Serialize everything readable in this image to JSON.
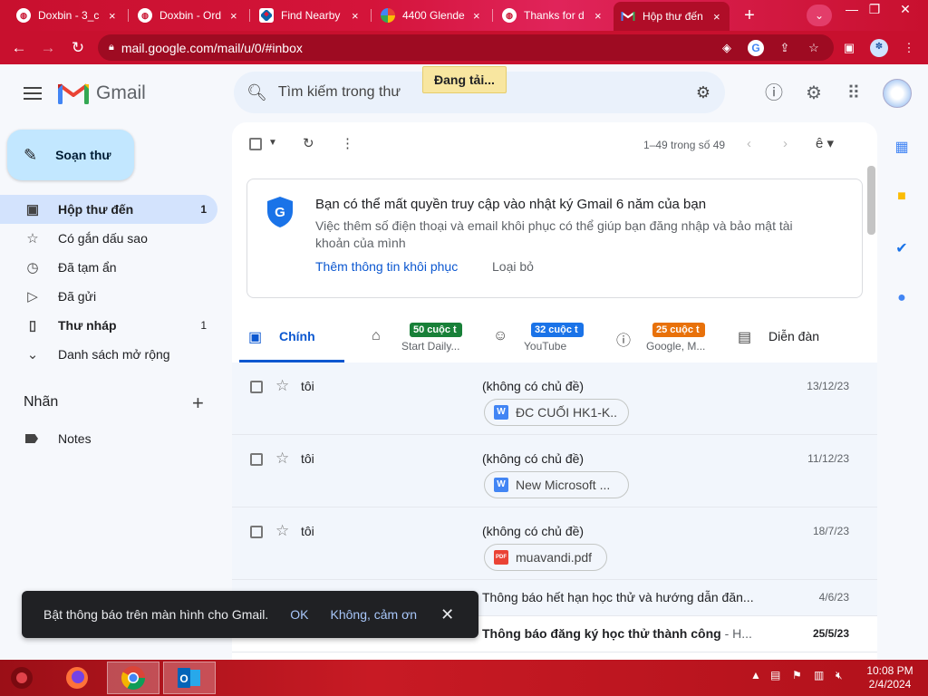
{
  "browser": {
    "tabs": [
      {
        "label": "Doxbin - 3_c",
        "close": "×"
      },
      {
        "label": "Doxbin - Ord",
        "close": "×"
      },
      {
        "label": "Find Nearby",
        "close": "×"
      },
      {
        "label": "4400 Glende",
        "close": "×"
      },
      {
        "label": "Thanks for d",
        "close": "×"
      },
      {
        "label": "Hộp thư đến",
        "close": "×"
      }
    ],
    "url": "mail.google.com/mail/u/0/#inbox"
  },
  "gmail": {
    "brand": "Gmail",
    "search_placeholder": "Tìm kiếm trong thư",
    "loading": "Đang tải...",
    "compose": "Soạn thư",
    "nav": [
      {
        "label": "Hộp thư đến",
        "count": "1"
      },
      {
        "label": "Có gắn dấu sao",
        "count": ""
      },
      {
        "label": "Đã tạm ẩn",
        "count": ""
      },
      {
        "label": "Đã gửi",
        "count": ""
      },
      {
        "label": "Thư nháp",
        "count": "1"
      },
      {
        "label": "Danh sách mở rộng",
        "count": ""
      }
    ],
    "labels_title": "Nhãn",
    "labels": [
      {
        "label": "Notes"
      }
    ],
    "pager": "1–49 trong số 49",
    "banner": {
      "title": "Bạn có thể mất quyền truy cập vào nhật ký Gmail 6 năm của bạn",
      "desc": "Việc thêm số điện thoại và email khôi phục có thể giúp bạn đăng nhập và bảo mật tài khoản của mình",
      "action": "Thêm thông tin khôi phục",
      "dismiss": "Loại bỏ"
    },
    "category_tabs": [
      {
        "name": "Chính"
      },
      {
        "badge": "50 cuộc t",
        "sub": "Start Daily...",
        "badge_color": "#188038"
      },
      {
        "badge": "32 cuộc t",
        "sub": "YouTube",
        "badge_color": "#1a73e8"
      },
      {
        "badge": "25 cuộc t",
        "sub": "Google, M...",
        "badge_color": "#e8710a"
      },
      {
        "name": "Diễn đàn"
      }
    ],
    "emails": [
      {
        "sender": "tôi",
        "subject": "(không có chủ đề)",
        "date": "13/12/23",
        "attachment": "ĐC CUỐI HK1-K...",
        "type": "W"
      },
      {
        "sender": "tôi",
        "subject": "(không có chủ đề)",
        "date": "11/12/23",
        "attachment": "New Microsoft ...",
        "type": "W"
      },
      {
        "sender": "tôi",
        "subject": "(không có chủ đề)",
        "date": "18/7/23",
        "attachment": "muavandi.pdf",
        "type": "PDF"
      },
      {
        "subject": "Thông báo hết hạn học thử và hướng dẫn đăn...",
        "date": "4/6/23"
      },
      {
        "subject": "Thông báo đăng ký học thử thành công",
        "snippet": " - H...",
        "date": "25/5/23"
      }
    ],
    "snackbar": {
      "message": "Bật thông báo trên màn hình cho Gmail.",
      "ok": "OK",
      "no": "Không, cảm ơn"
    }
  },
  "taskbar": {
    "time": "10:08 PM",
    "date": "2/4/2024"
  },
  "colors": {
    "brand_red": "#c8102e",
    "gmail_blue": "#0b57d0",
    "compose_bg": "#c2e7ff",
    "active_nav": "#d3e3fd"
  }
}
